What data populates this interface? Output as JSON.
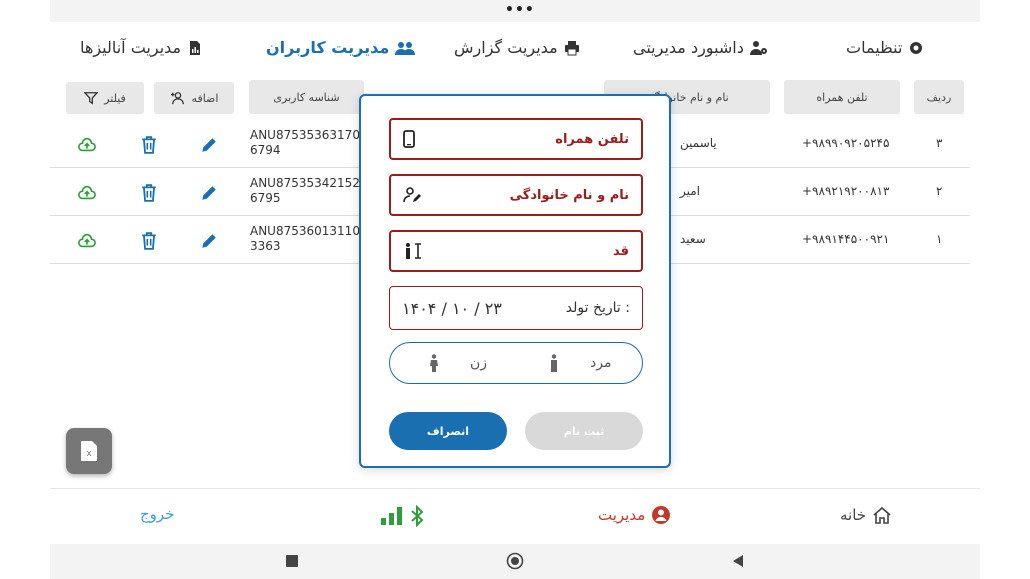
{
  "nav": {
    "analytics": "مدیریت آنالیزها",
    "users": "مدیریت کاربران",
    "reports": "مدیریت گزارش",
    "dashboard": "داشبورد مدیریتی",
    "settings": "تنظیمات"
  },
  "toolbar": {
    "filter": "فیلتر",
    "add": "اضافه"
  },
  "table": {
    "headers": {
      "index": "ردیف",
      "phone": "تلفن همراه",
      "name": "نام و نام خانوادگی",
      "uid": "شناسه کاربری"
    },
    "rows": [
      {
        "index": "۳",
        "phone": "+۹۸۹۹۰۹۲۰۵۲۴۵",
        "name": "یاسمین",
        "uid": "ANU875353631706794"
      },
      {
        "index": "۲",
        "phone": "+۹۸۹۲۱۹۲۰۰۸۱۳",
        "name": "امیر",
        "uid": "ANU875353421526795"
      },
      {
        "index": "۱",
        "phone": "+۹۸۹۱۴۴۵۰۰۹۲۱",
        "name": "سعید",
        "uid": "ANU875360131103363"
      }
    ]
  },
  "modal": {
    "phone_label": "تلفن همراه",
    "name_label": "نام و نام خانوادگی",
    "height_label": "قد",
    "dob_label": "تاریخ تولد :",
    "dob_value": "۱۴۰۴ / ۱۰ / ۲۳",
    "male_label": "مرد",
    "female_label": "زن",
    "cancel_label": "انصراف",
    "submit_label": "ثبت نام"
  },
  "bottom": {
    "exit": "خروج",
    "management": "مدیریت",
    "home": "خانه"
  },
  "colors": {
    "primary": "#1a6fb0",
    "field_border": "#9b1c1c",
    "accent_red": "#c0392b",
    "green": "#2e9e3a"
  }
}
